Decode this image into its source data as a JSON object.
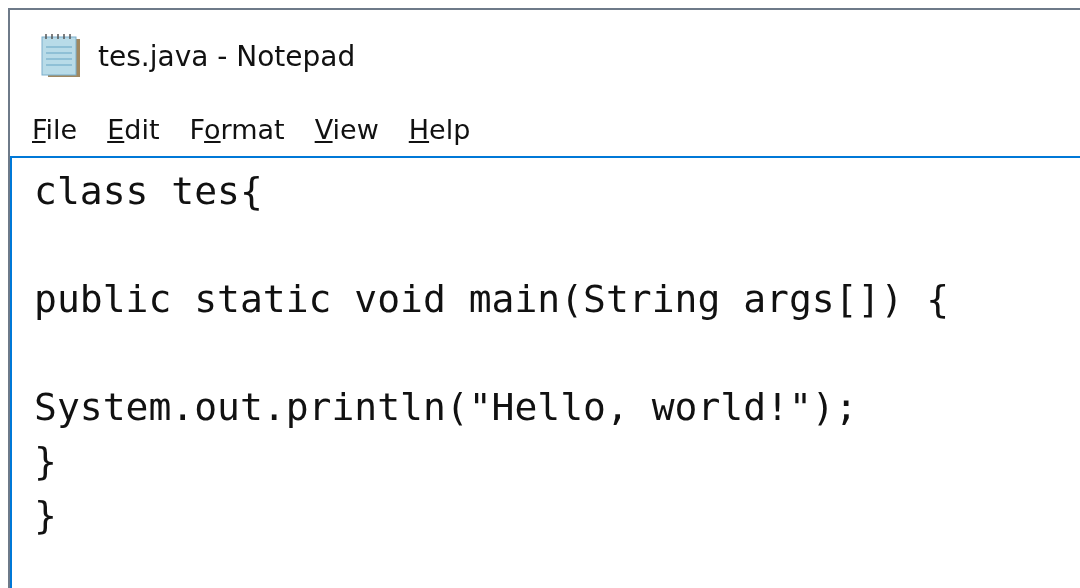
{
  "window": {
    "title": "tes.java - Notepad"
  },
  "menu": [
    {
      "mnemonic": "F",
      "mnemonic_after": "ile"
    },
    {
      "mnemonic": "E",
      "mnemonic_after": "dit"
    },
    {
      "mnemonic_before": "F",
      "mnemonic": "o",
      "mnemonic_after": "rmat"
    },
    {
      "mnemonic": "V",
      "mnemonic_after": "iew"
    },
    {
      "mnemonic": "H",
      "mnemonic_after": "elp"
    }
  ],
  "editor": {
    "text": "class tes{\n\npublic static void main(String args[]) {\n\nSystem.out.println(\"Hello, world!\");\n}\n}",
    "focused": true
  }
}
